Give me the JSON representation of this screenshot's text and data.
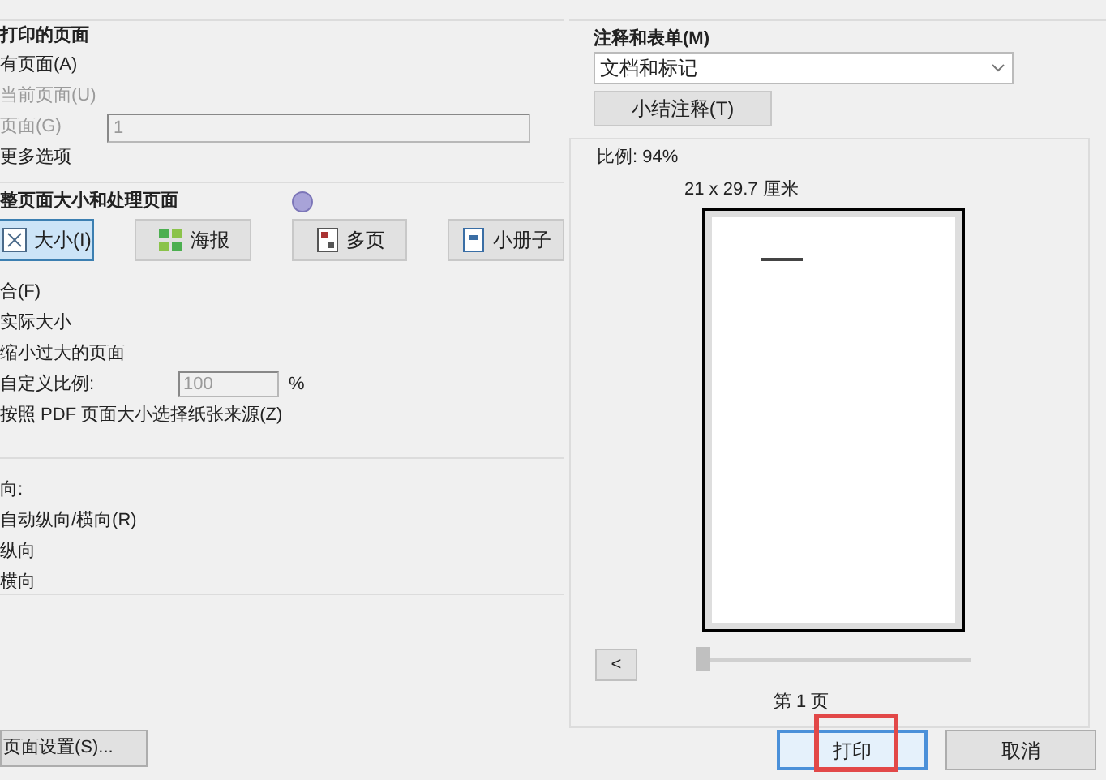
{
  "pages_to_print": {
    "title": "打印的页面",
    "options": [
      {
        "label": "有页面(A)",
        "disabled": false
      },
      {
        "label": "当前页面(U)",
        "disabled": true
      },
      {
        "label": "页面(G)",
        "disabled": true,
        "kind": "range",
        "value": "1"
      },
      {
        "label": "更多选项",
        "disabled": false
      }
    ]
  },
  "page_sizing": {
    "title": "整页面大小和处理页面",
    "modes": [
      {
        "label": "大小(I)",
        "selected": true
      },
      {
        "label": "海报",
        "selected": false
      },
      {
        "label": "多页",
        "selected": false
      },
      {
        "label": "小册子",
        "selected": false
      }
    ],
    "options": [
      {
        "label": "合(F)"
      },
      {
        "label": "实际大小"
      },
      {
        "label": "缩小过大的页面"
      },
      {
        "label": "自定义比例:",
        "kind": "scale",
        "value": "100",
        "unit": "%"
      },
      {
        "label": "按照 PDF 页面大小选择纸张来源(Z)"
      }
    ]
  },
  "orientation": {
    "title": "向:",
    "options": [
      {
        "label": "自动纵向/横向(R)"
      },
      {
        "label": "纵向"
      },
      {
        "label": "横向"
      }
    ]
  },
  "page_setup_button": "页面设置(S)...",
  "comments_forms": {
    "title": "注释和表单(M)",
    "dropdown": "文档和标记",
    "summarize_button": "小结注释(T)"
  },
  "preview": {
    "scale": "比例:  94%",
    "size": "21 x 29.7 厘米",
    "prev_button": "<",
    "slider": {
      "level": 0
    },
    "page_label": "第 1 页"
  },
  "buttons": [
    {
      "label": "打印",
      "highlighted": true
    },
    {
      "label": "取消",
      "highlighted": false
    }
  ]
}
